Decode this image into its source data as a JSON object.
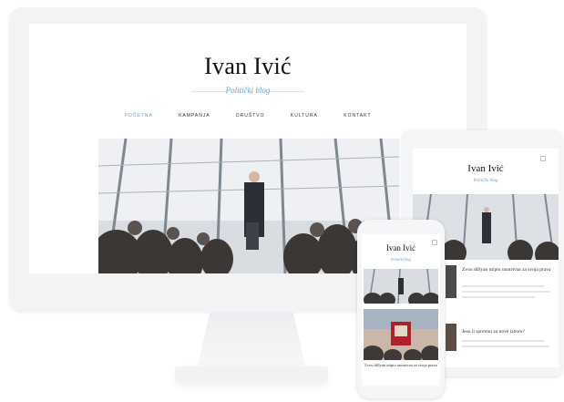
{
  "desktop": {
    "title": "Ivan Ivić",
    "tagline": "Politički blog",
    "nav": [
      "POČETNA",
      "KAMPANJA",
      "DRUŠTVO",
      "KULTURA",
      "KONTAKT"
    ]
  },
  "tablet": {
    "title": "Ivan Ivić",
    "tagline": "Politički blog",
    "post1_title": "Zvou dillyan utiptu unutrtvaa za svoja prava",
    "post2_title": "Jesu li spremni za nove izbore?"
  },
  "phone": {
    "title": "Ivan Ivić",
    "tagline": "Politički blog",
    "post_title": "Zvou dillyan utiptu unutrtvaa za svoja prava"
  },
  "colors": {
    "accent": "#6aa0c6",
    "device_frame": "#f2f3f5"
  }
}
